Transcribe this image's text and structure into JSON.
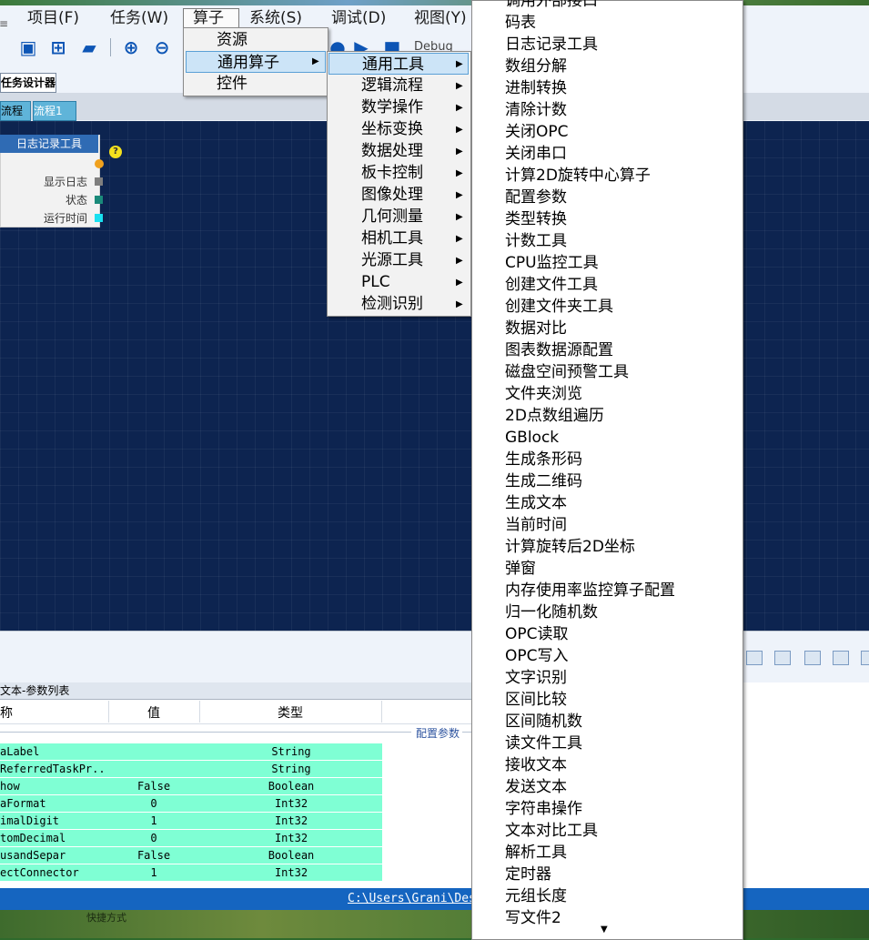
{
  "menubar": {
    "items": [
      {
        "label": "项目(F)"
      },
      {
        "label": "任务(W)"
      },
      {
        "label": "算子"
      },
      {
        "label": "系统(S)"
      },
      {
        "label": "调试(D)"
      },
      {
        "label": "视图(Y)"
      }
    ]
  },
  "toolbar": {
    "debug_label": "Debug",
    "icons": [
      "save-icon",
      "add-icon",
      "open-folder-icon",
      "zoom-in-icon",
      "zoom-out-icon",
      "run-icon",
      "step-icon",
      "stop-icon"
    ]
  },
  "tabs": {
    "designer": "任务设计器",
    "flow_a": "流程",
    "flow_b": "流程1"
  },
  "node": {
    "title": "日志记录工具",
    "help": "?",
    "ports": [
      {
        "label": "显示日志",
        "color": "#7f7f7f"
      },
      {
        "label": "状态",
        "color": "#1a8a7a"
      },
      {
        "label": "运行时间",
        "color": "#19e0f0"
      }
    ]
  },
  "params": {
    "panel_title": "文本-参数列表",
    "col_name": "称",
    "col_value": "值",
    "col_type": "类型",
    "group_label": "配置参数",
    "rows": [
      {
        "name": "aLabel",
        "value": "",
        "type": "String"
      },
      {
        "name": "ReferredTaskPr...",
        "value": "",
        "type": "String"
      },
      {
        "name": "how",
        "value": "False",
        "type": "Boolean"
      },
      {
        "name": "aFormat",
        "value": "0",
        "type": "Int32"
      },
      {
        "name": "imalDigit",
        "value": "1",
        "type": "Int32"
      },
      {
        "name": "tomDecimal",
        "value": "0",
        "type": "Int32"
      },
      {
        "name": "usandSepar",
        "value": "False",
        "type": "Boolean"
      },
      {
        "name": "ectConnector",
        "value": "1",
        "type": "Int32"
      }
    ]
  },
  "status": {
    "path": "C:\\Users\\Grani\\Desk"
  },
  "desktop": {
    "bottom_text": "快捷方式"
  },
  "menu_ops": {
    "items": [
      {
        "label": "资源"
      },
      {
        "label": "通用算子"
      },
      {
        "label": "控件"
      }
    ]
  },
  "menu_general": {
    "items": [
      {
        "label": "通用工具"
      },
      {
        "label": "逻辑流程"
      },
      {
        "label": "数学操作"
      },
      {
        "label": "坐标变换"
      },
      {
        "label": "数据处理"
      },
      {
        "label": "板卡控制"
      },
      {
        "label": "图像处理"
      },
      {
        "label": "几何测量"
      },
      {
        "label": "相机工具"
      },
      {
        "label": "光源工具"
      },
      {
        "label": "PLC"
      },
      {
        "label": "检测识别"
      }
    ]
  },
  "menu_tools": {
    "items": [
      {
        "label": "调用外部接口"
      },
      {
        "label": "码表"
      },
      {
        "label": "日志记录工具"
      },
      {
        "label": "数组分解"
      },
      {
        "label": "进制转换"
      },
      {
        "label": "清除计数"
      },
      {
        "label": "关闭OPC"
      },
      {
        "label": "关闭串口"
      },
      {
        "label": "计算2D旋转中心算子"
      },
      {
        "label": "配置参数"
      },
      {
        "label": "类型转换"
      },
      {
        "label": "计数工具"
      },
      {
        "label": "CPU监控工具"
      },
      {
        "label": "创建文件工具"
      },
      {
        "label": "创建文件夹工具"
      },
      {
        "label": "数据对比"
      },
      {
        "label": "图表数据源配置"
      },
      {
        "label": "磁盘空间预警工具"
      },
      {
        "label": "文件夹浏览"
      },
      {
        "label": "2D点数组遍历"
      },
      {
        "label": "GBlock"
      },
      {
        "label": "生成条形码"
      },
      {
        "label": "生成二维码"
      },
      {
        "label": "生成文本"
      },
      {
        "label": "当前时间"
      },
      {
        "label": "计算旋转后2D坐标"
      },
      {
        "label": "弹窗"
      },
      {
        "label": "内存使用率监控算子配置"
      },
      {
        "label": "归一化随机数"
      },
      {
        "label": "OPC读取"
      },
      {
        "label": "OPC写入"
      },
      {
        "label": "文字识别"
      },
      {
        "label": "区间比较"
      },
      {
        "label": "区间随机数"
      },
      {
        "label": "读文件工具"
      },
      {
        "label": "接收文本"
      },
      {
        "label": "发送文本"
      },
      {
        "label": "字符串操作"
      },
      {
        "label": "文本对比工具"
      },
      {
        "label": "解析工具"
      },
      {
        "label": "定时器"
      },
      {
        "label": "元组长度"
      },
      {
        "label": "写文件2"
      }
    ]
  }
}
